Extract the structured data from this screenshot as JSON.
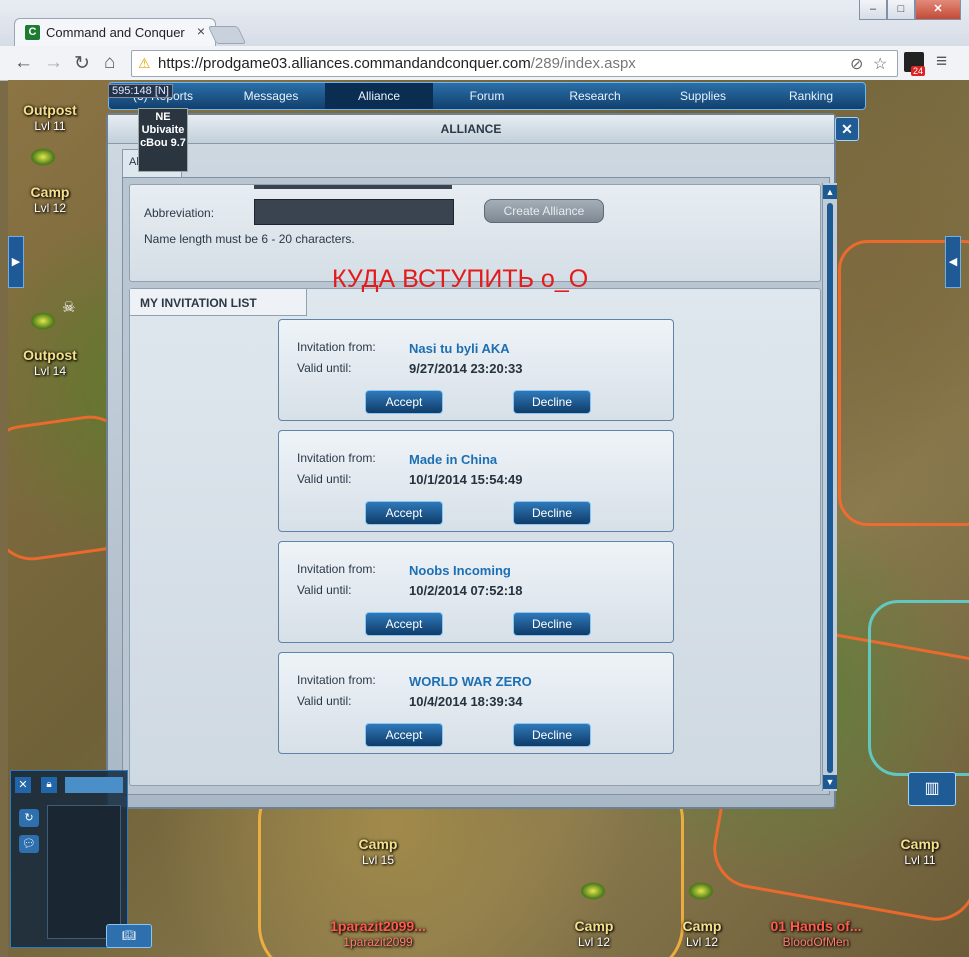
{
  "browser": {
    "tab_title": "Command and Conquer",
    "tab_close": "×",
    "favicon": "C",
    "url_host": "https://prodgame03.alliances.commandandconquer.com",
    "url_path": "/289/index.aspx",
    "ext_badge": "24",
    "window_buttons": [
      "–",
      "□",
      "✕"
    ]
  },
  "game_nav": {
    "items": [
      "(3) Reports",
      "Messages",
      "Alliance",
      "Forum",
      "Research",
      "Supplies",
      "Ranking"
    ],
    "active": "Alliance"
  },
  "tooltip": {
    "coords": "595:148 [N]",
    "name_tag": "NE Ubivaite cBou 9.7"
  },
  "map_labels": [
    {
      "name": "Outpost",
      "level": "Lvl 11"
    },
    {
      "name": "Camp",
      "level": "Lvl 12"
    },
    {
      "name": "Outpost",
      "level": "Lvl 14"
    },
    {
      "name": "Camp",
      "level": "Lvl 15"
    },
    {
      "name": "Camp",
      "level": "Lvl 11"
    },
    {
      "name": "Camp",
      "level": "Lvl 12"
    },
    {
      "name": "Camp",
      "level": "Lvl 12"
    },
    {
      "name": "1parazit2099...",
      "level": "1parazit2099"
    },
    {
      "name": "01 Hands of...",
      "level": "BloodOfMen"
    }
  ],
  "window": {
    "title": "ALLIANCE",
    "tab_label": "Alliance",
    "close": "✕"
  },
  "create": {
    "abbreviation_label": "Abbreviation:",
    "button_label": "Create Alliance",
    "hint": "Name length must be 6 - 20 characters."
  },
  "overlay_text": "КУДА ВСТУПИТЬ о_О",
  "invitations": {
    "heading": "MY INVITATION LIST",
    "from_label": "Invitation from:",
    "valid_label": "Valid until:",
    "accept_label": "Accept",
    "decline_label": "Decline",
    "items": [
      {
        "from": "Nasi tu byli AKA",
        "valid_until": "9/27/2014 23:20:33"
      },
      {
        "from": "Made in China",
        "valid_until": "10/1/2014 15:54:49"
      },
      {
        "from": "Noobs Incoming",
        "valid_until": "10/2/2014 07:52:18"
      },
      {
        "from": "WORLD WAR ZERO",
        "valid_until": "10/4/2014 18:39:34"
      }
    ]
  }
}
